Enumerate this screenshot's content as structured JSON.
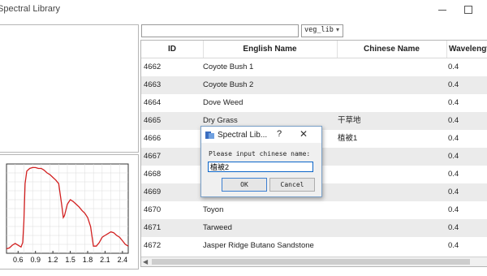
{
  "window": {
    "title": "Spectral Library"
  },
  "search": {
    "value": "",
    "placeholder": ""
  },
  "library_select": {
    "value": "veg_lib"
  },
  "table": {
    "columns": [
      "ID",
      "English Name",
      "Chinese Name",
      "Wavelength"
    ],
    "rows": [
      {
        "id": "4662",
        "english": "Coyote Bush 1",
        "chinese": "",
        "wavelength": "0.4"
      },
      {
        "id": "4663",
        "english": "Coyote Bush 2",
        "chinese": "",
        "wavelength": "0.4"
      },
      {
        "id": "4664",
        "english": "Dove Weed",
        "chinese": "",
        "wavelength": "0.4"
      },
      {
        "id": "4665",
        "english": "Dry Grass",
        "chinese": "干草地",
        "wavelength": "0.4"
      },
      {
        "id": "4666",
        "english": "",
        "chinese": "植被1",
        "wavelength": "0.4"
      },
      {
        "id": "4667",
        "english": "",
        "chinese": "",
        "wavelength": "0.4"
      },
      {
        "id": "4668",
        "english": "",
        "chinese": "",
        "wavelength": "0.4"
      },
      {
        "id": "4669",
        "english": "",
        "chinese": "",
        "wavelength": "0.4"
      },
      {
        "id": "4670",
        "english": "Toyon",
        "chinese": "",
        "wavelength": "0.4"
      },
      {
        "id": "4671",
        "english": "Tarweed",
        "chinese": "",
        "wavelength": "0.4"
      },
      {
        "id": "4672",
        "english": "Jasper Ridge Butano Sandstone",
        "chinese": "",
        "wavelength": "0.4"
      }
    ]
  },
  "dialog": {
    "title": "Spectral Lib...",
    "help": "?",
    "close": "✕",
    "prompt": "Please input chinese name:",
    "input_value": "植被2",
    "ok_label": "OK",
    "cancel_label": "Cancel"
  },
  "chart_data": {
    "type": "line",
    "xticks": [
      "0.6",
      "0.9",
      "1.2",
      "1.5",
      "1.8",
      "2.1",
      "2.4"
    ],
    "xlim": [
      0.4,
      2.5
    ],
    "ylim": [
      0,
      1
    ],
    "series": [
      {
        "color": "#d22020",
        "x": [
          0.4,
          0.45,
          0.5,
          0.55,
          0.6,
          0.65,
          0.68,
          0.7,
          0.72,
          0.75,
          0.8,
          0.85,
          0.9,
          0.95,
          1.0,
          1.05,
          1.1,
          1.15,
          1.2,
          1.25,
          1.3,
          1.35,
          1.38,
          1.4,
          1.45,
          1.5,
          1.55,
          1.6,
          1.65,
          1.7,
          1.75,
          1.8,
          1.85,
          1.9,
          1.95,
          2.0,
          2.05,
          2.1,
          2.15,
          2.2,
          2.25,
          2.3,
          2.35,
          2.4,
          2.45,
          2.5
        ],
        "y": [
          0.05,
          0.06,
          0.09,
          0.11,
          0.09,
          0.07,
          0.12,
          0.35,
          0.78,
          0.92,
          0.95,
          0.96,
          0.96,
          0.95,
          0.95,
          0.93,
          0.9,
          0.88,
          0.85,
          0.82,
          0.78,
          0.55,
          0.4,
          0.42,
          0.55,
          0.6,
          0.58,
          0.55,
          0.52,
          0.48,
          0.45,
          0.4,
          0.3,
          0.08,
          0.08,
          0.12,
          0.18,
          0.2,
          0.22,
          0.24,
          0.23,
          0.2,
          0.18,
          0.14,
          0.1,
          0.08
        ]
      }
    ],
    "grid": true
  },
  "colors": {
    "accent": "#0a64c8",
    "row_alt": "#ebebeb",
    "plot_line": "#d22020"
  }
}
